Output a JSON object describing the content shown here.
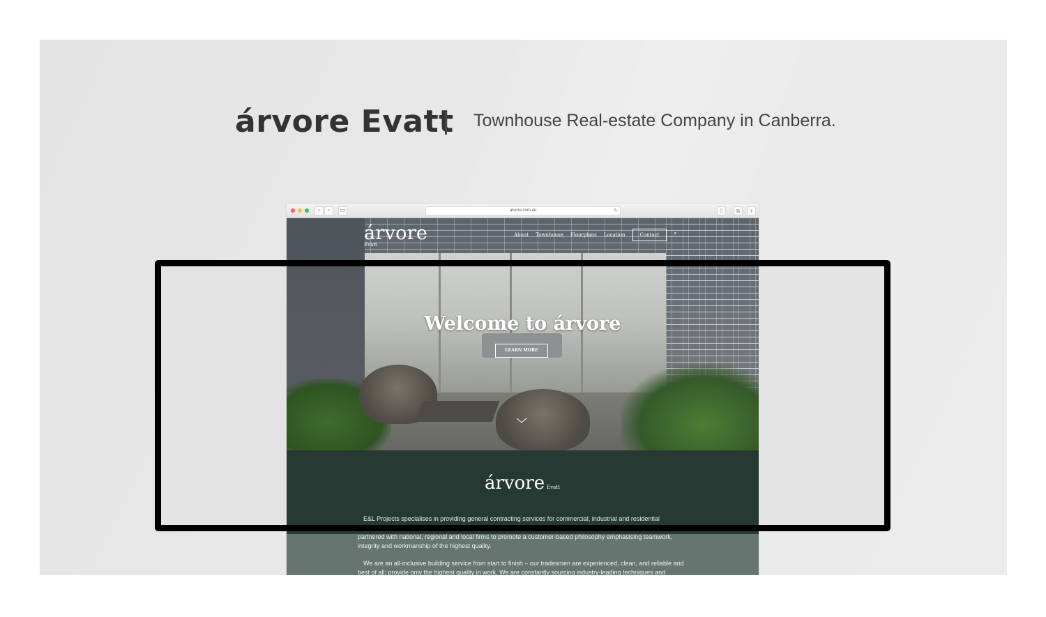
{
  "header": {
    "title": "árvore Evatt",
    "tagline": "Townhouse Real-estate Company in Canberra."
  },
  "browser": {
    "url": "arvore.com.au"
  },
  "site": {
    "logo": "árvore",
    "logo_sub": "Evatt",
    "nav": [
      "About",
      "Townhouse",
      "Floorplans",
      "Location",
      "Contact"
    ],
    "hero_title": "Welcome to árvore",
    "hero_button": "LEARN MORE",
    "about_logo": "árvore",
    "about_logo_sub": "Evatt",
    "paragraph_1": "E&L Projects specialises in providing general contracting services for commercial, industrial and residential properties in the ACT and its surrounding areas. We are a locally owned and operated company, and have successfully partnered with national, regional and local firms to promote a customer-based philosophy emphasising teamwork, integrity and workmanship of the highest quality.",
    "paragraph_2": "We are an all-inclusive building service from start to finish – our tradesmen are experienced, clean, and reliable and best of all; provide only the highest quality in work. We are constantly sourcing industry-leading techniques and diversifying our skilled"
  },
  "colors": {
    "brand_green": "#263a33",
    "frame": "#000000"
  }
}
